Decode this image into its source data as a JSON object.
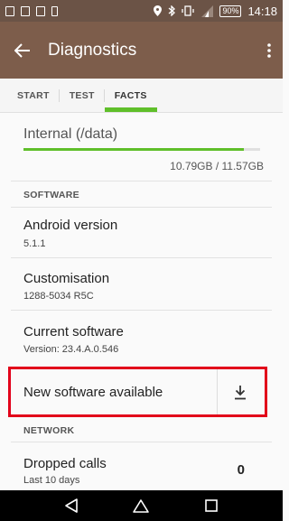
{
  "status_bar": {
    "battery": "90%",
    "time": "14:18"
  },
  "app_bar": {
    "title": "Diagnostics"
  },
  "tabs": [
    {
      "label": "START",
      "active": false
    },
    {
      "label": "TEST",
      "active": false
    },
    {
      "label": "FACTS",
      "active": true
    }
  ],
  "storage": {
    "title": "Internal (/data)",
    "value": "10.79GB / 11.57GB",
    "used_fraction": 0.933
  },
  "software": {
    "header": "SOFTWARE",
    "android_version": {
      "title": "Android version",
      "value": "5.1.1"
    },
    "customisation": {
      "title": "Customisation",
      "value": "1288-5034 R5C"
    },
    "current_software": {
      "title": "Current software",
      "value": "Version: 23.4.A.0.546"
    },
    "new_software": {
      "title": "New software available"
    }
  },
  "network": {
    "header": "NETWORK",
    "dropped_calls": {
      "title": "Dropped calls",
      "sub": "Last 10 days",
      "value": "0"
    }
  },
  "colors": {
    "status_bar": "#6b5346",
    "app_bar": "#7d5d4b",
    "accent": "#5fbf2a",
    "highlight": "#e2001a"
  }
}
